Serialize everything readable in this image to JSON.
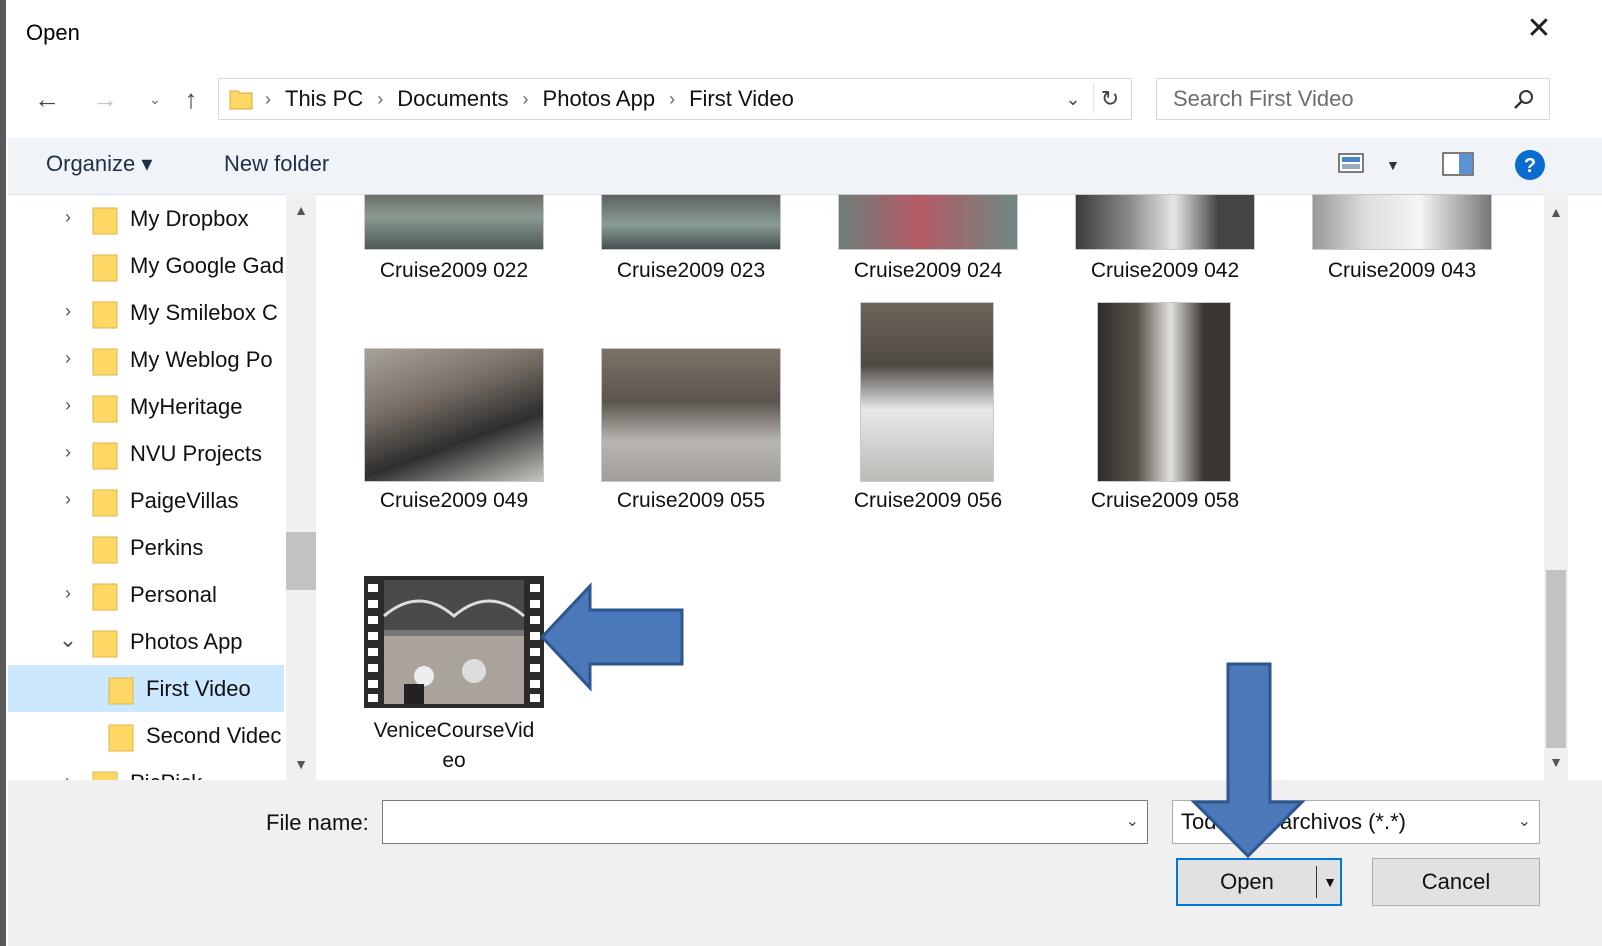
{
  "dialog": {
    "title": "Open",
    "close_icon": "close-icon"
  },
  "nav": {
    "back_icon": "back-arrow-icon",
    "forward_icon": "forward-arrow-icon",
    "recent_icon": "chevron-down-icon",
    "up_icon": "up-arrow-icon",
    "breadcrumbs": [
      "This PC",
      "Documents",
      "Photos App",
      "First Video"
    ],
    "refresh_icon": "refresh-icon"
  },
  "search": {
    "placeholder": "Search First Video"
  },
  "toolbar": {
    "organize_label": "Organize ▾",
    "new_folder_label": "New folder",
    "help_symbol": "?"
  },
  "sidebar": {
    "items": [
      {
        "label": "My Dropbox",
        "expandable": true
      },
      {
        "label": "My Google Gad",
        "expandable": false
      },
      {
        "label": "My Smilebox C",
        "expandable": true
      },
      {
        "label": "My Weblog Po",
        "expandable": true
      },
      {
        "label": "MyHeritage",
        "expandable": true
      },
      {
        "label": "NVU Projects",
        "expandable": true
      },
      {
        "label": "PaigeVillas",
        "expandable": true
      },
      {
        "label": "Perkins",
        "expandable": false
      },
      {
        "label": "Personal",
        "expandable": true
      },
      {
        "label": "Photos App",
        "expandable": true,
        "expanded": true
      },
      {
        "label": "First Video",
        "selected": true,
        "child": true
      },
      {
        "label": "Second Videc",
        "child": true
      },
      {
        "label": "PicPick",
        "expandable": true
      }
    ]
  },
  "files": [
    {
      "name": "Cruise2009 022"
    },
    {
      "name": "Cruise2009 023"
    },
    {
      "name": "Cruise2009 024"
    },
    {
      "name": "Cruise2009 042"
    },
    {
      "name": "Cruise2009 043"
    },
    {
      "name": "Cruise2009 049"
    },
    {
      "name": "Cruise2009 055"
    },
    {
      "name": "Cruise2009 056"
    },
    {
      "name": "Cruise2009 058"
    },
    {
      "name_line1": "VeniceCourseVid",
      "name_line2": "eo",
      "type": "video"
    }
  ],
  "footer": {
    "file_name_label": "File name:",
    "file_name_value": "",
    "file_type_value": "Todos los archivos (*.*)",
    "open_label": "Open",
    "cancel_label": "Cancel"
  },
  "colors": {
    "accent": "#0078d7",
    "selected_bg": "#cce8ff",
    "folder_yellow": "#ffd764",
    "annotation_arrow": "#4a78b8"
  }
}
